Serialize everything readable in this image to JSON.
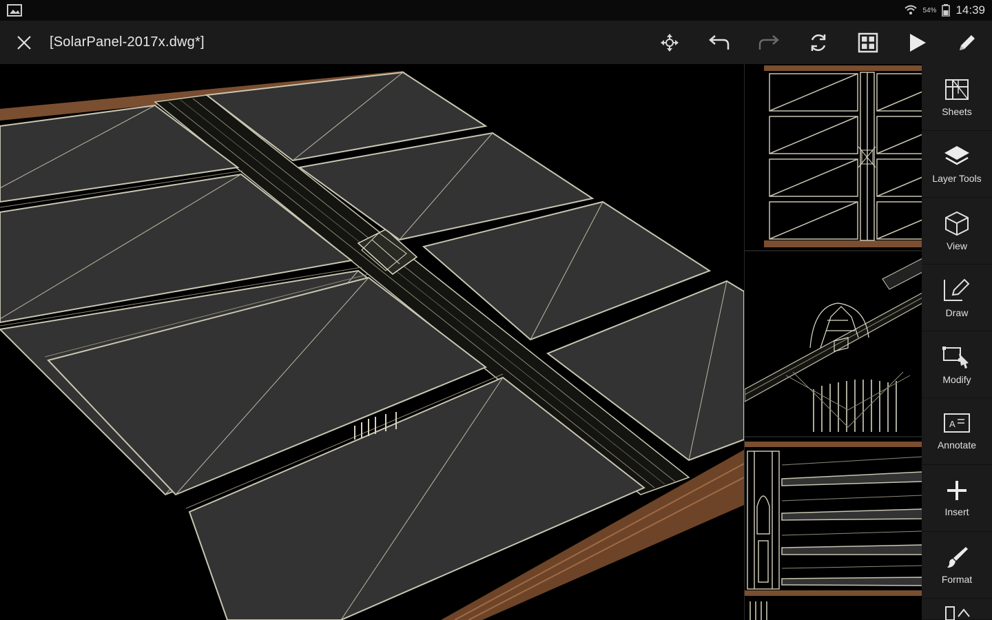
{
  "status_bar": {
    "time": "14:39",
    "battery": "54%",
    "icons": [
      "gallery-icon",
      "wifi-icon",
      "battery-icon"
    ]
  },
  "toolbar": {
    "title": "[SolarPanel-2017x.dwg*]",
    "actions": [
      "move-icon",
      "undo-icon",
      "redo-icon",
      "sync-icon",
      "grid-icon",
      "play-icon",
      "pencil-icon"
    ]
  },
  "sidebar": {
    "items": [
      {
        "label": "Sheets",
        "icon": "sheets-icon"
      },
      {
        "label": "Layer Tools",
        "icon": "layers-icon"
      },
      {
        "label": "View",
        "icon": "cube-icon"
      },
      {
        "label": "Draw",
        "icon": "draw-icon"
      },
      {
        "label": "Modify",
        "icon": "modify-icon"
      },
      {
        "label": "Annotate",
        "icon": "annotate-icon"
      },
      {
        "label": "Insert",
        "icon": "plus-icon"
      },
      {
        "label": "Format",
        "icon": "brush-icon"
      }
    ]
  },
  "colors": {
    "toolbar_bg": "#1b1b1c",
    "panel_fill": "#333333",
    "frame": "#c9c6b2",
    "wood": "#8a5a3a"
  }
}
